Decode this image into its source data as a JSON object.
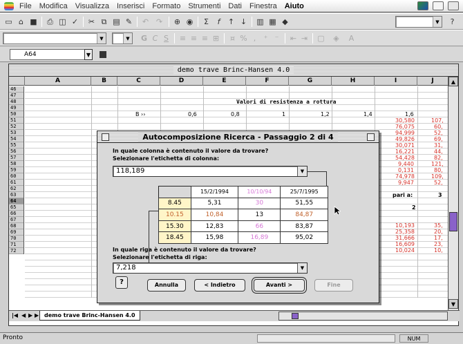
{
  "menubar": {
    "items": [
      "File",
      "Modifica",
      "Visualizza",
      "Inserisci",
      "Formato",
      "Strumenti",
      "Dati",
      "Finestra",
      "Aiuto"
    ]
  },
  "namebox": {
    "value": "A64"
  },
  "workbook": {
    "title": "demo trave Brinc-Hansen 4.0",
    "columns": [
      "A",
      "B",
      "C",
      "D",
      "E",
      "F",
      "G",
      "H",
      "I",
      "J"
    ],
    "rows": [
      "46",
      "47",
      "48",
      "49",
      "50",
      "51",
      "52",
      "53",
      "54",
      "55",
      "56",
      "57",
      "58",
      "59",
      "60",
      "61",
      "62",
      "63",
      "64",
      "65",
      "66",
      "67",
      "68",
      "69",
      "70",
      "71",
      "72"
    ],
    "selected_row": "64",
    "cells": {
      "heading": "Valori di resistenza a rottura",
      "b_label": "B ››",
      "r49_d": "0,6",
      "r49_e": "0,8",
      "r49_f": "1",
      "r49_g": "1,2",
      "r49_h": "1,4",
      "r49_i": "1,6",
      "col_i_upper": [
        "30,580",
        "76,075",
        "94,999",
        "49,826",
        "30,071",
        "16,221",
        "54,428",
        "9,440",
        "0,131",
        "74,978",
        "9,947"
      ],
      "col_j_upper": [
        "107,",
        "60,",
        "52,",
        "69,",
        "31,",
        "44,",
        "82,",
        "121,",
        "80,",
        "109,",
        "52,"
      ],
      "r64_label": "pari a:",
      "r64_j": "3",
      "r65_i": "2",
      "col_i_lower": [
        "10,193",
        "25,358",
        "31,666",
        "16,609",
        "10,024"
      ],
      "col_j_lower": [
        "35,",
        "20,",
        "17,",
        "23,",
        "10,"
      ]
    },
    "sheet_tab": "demo trave Brinc-Hansen 4.0"
  },
  "dialog": {
    "title": "Autocomposizione Ricerca - Passaggio 2 di 4",
    "q_column": "In quale colonna è contenuto il valore da trovare?",
    "q_column_hint": "Selezionare l'etichetta di colonna:",
    "column_value": "118,189",
    "preview_header": [
      "15/2/1994",
      "10/10/94",
      "25/7/1995"
    ],
    "preview_rows": [
      [
        "8.45",
        "5,31",
        "30",
        "51,55"
      ],
      [
        "10.15",
        "10,84",
        "13",
        "84,87"
      ],
      [
        "15.30",
        "12,83",
        "66",
        "83,87"
      ],
      [
        "18.45",
        "15,98",
        "16,89",
        "95,02"
      ]
    ],
    "q_row": "In quale riga è contenuto il valore da trovare?",
    "q_row_hint": "Selezionare l'etichetta di riga:",
    "row_value": "7,218",
    "buttons": {
      "cancel": "Annulla",
      "back": "< Indietro",
      "next": "Avanti >",
      "finish": "Fine"
    }
  },
  "status": {
    "text": "Pronto",
    "num": "NUM"
  }
}
